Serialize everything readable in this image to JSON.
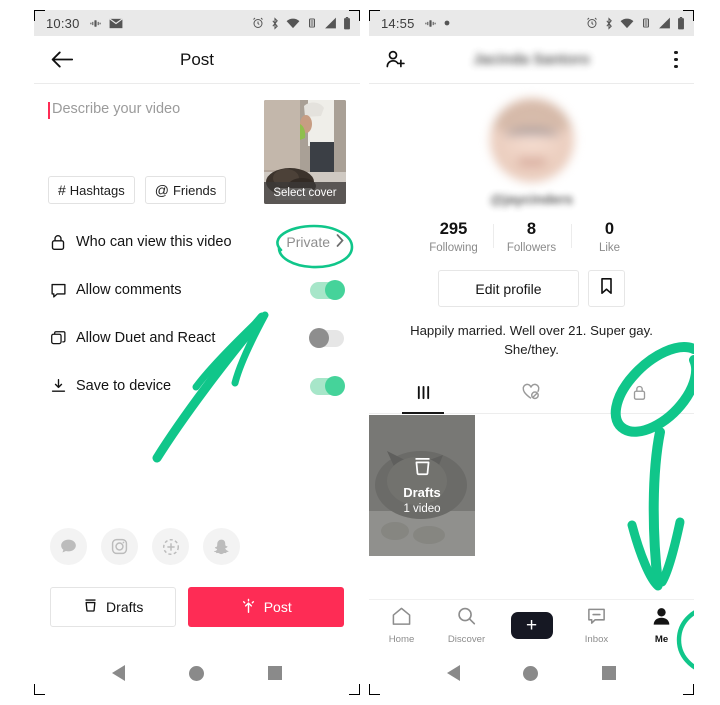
{
  "annotation": {
    "color": "#10c68a"
  },
  "left_phone": {
    "status_bar": {
      "time": "10:30",
      "left_icons": [
        "vibrate-icon",
        "mail-icon"
      ],
      "right_icons": [
        "alarm-icon",
        "bluetooth-icon",
        "wifi-icon",
        "vibrate-icon",
        "signal-icon",
        "battery-icon"
      ]
    },
    "header": {
      "back_icon": "back-arrow-icon",
      "title": "Post"
    },
    "compose": {
      "caption_placeholder": "Describe your video",
      "caption_value": "",
      "chips": [
        {
          "icon": "hashtag-icon",
          "label": "Hashtags"
        },
        {
          "icon": "at-icon",
          "label": "Friends"
        }
      ],
      "cover_label": "Select cover"
    },
    "settings": [
      {
        "icon": "lock-icon",
        "label": "Who can view this video",
        "value": "Private",
        "control": "chevron"
      },
      {
        "icon": "comment-icon",
        "label": "Allow comments",
        "control": "toggle",
        "state": "on"
      },
      {
        "icon": "duet-icon",
        "label": "Allow Duet and React",
        "control": "toggle",
        "state": "off"
      },
      {
        "icon": "download-icon",
        "label": "Save to device",
        "control": "toggle",
        "state": "on"
      }
    ],
    "share_targets": [
      "message-icon",
      "instagram-icon",
      "instagram-story-icon",
      "snapchat-icon"
    ],
    "actions": {
      "drafts_label": "Drafts",
      "drafts_icon": "drafts-icon",
      "post_label": "Post",
      "post_icon": "sparkle-arrow-icon",
      "post_color": "#fe2c55"
    },
    "nav_bar": [
      "back-nav-icon",
      "home-nav-icon",
      "recents-nav-icon"
    ]
  },
  "right_phone": {
    "status_bar": {
      "time": "14:55",
      "left_icons": [
        "vibrate-icon",
        "dot-icon"
      ],
      "right_icons": [
        "alarm-icon",
        "bluetooth-icon",
        "wifi-icon",
        "vibrate-icon",
        "signal-icon",
        "battery-icon"
      ]
    },
    "header": {
      "add_friend_icon": "add-person-icon",
      "username": "Jacinda Santoro",
      "username_blurred": true,
      "dropdown_icon": "chevron-down-icon",
      "more_icon": "kebab-menu-icon"
    },
    "profile": {
      "avatar": "user-avatar",
      "handle": "@jaycinders",
      "handle_blurred": true,
      "stats": [
        {
          "value": "295",
          "label": "Following"
        },
        {
          "value": "8",
          "label": "Followers"
        },
        {
          "value": "0",
          "label": "Like"
        }
      ],
      "edit_profile_label": "Edit profile",
      "bookmark_icon": "bookmark-icon",
      "bio": "Happily married. Well over 21. Super gay. She/they."
    },
    "tabs": [
      {
        "icon": "grid-icon",
        "active": true
      },
      {
        "icon": "heart-hidden-icon",
        "active": false
      },
      {
        "icon": "lock-icon",
        "active": false
      }
    ],
    "drafts_card": {
      "title": "Drafts",
      "subtitle": "1 video",
      "icon": "drafts-icon"
    },
    "bottom_nav": [
      {
        "icon": "home-icon",
        "label": "Home",
        "active": false
      },
      {
        "icon": "search-icon",
        "label": "Discover",
        "active": false
      },
      {
        "icon": "plus-icon",
        "label": "",
        "active": false
      },
      {
        "icon": "inbox-icon",
        "label": "Inbox",
        "active": false
      },
      {
        "icon": "person-icon",
        "label": "Me",
        "active": true
      }
    ],
    "nav_bar": [
      "back-nav-icon",
      "home-nav-icon",
      "recents-nav-icon"
    ]
  }
}
